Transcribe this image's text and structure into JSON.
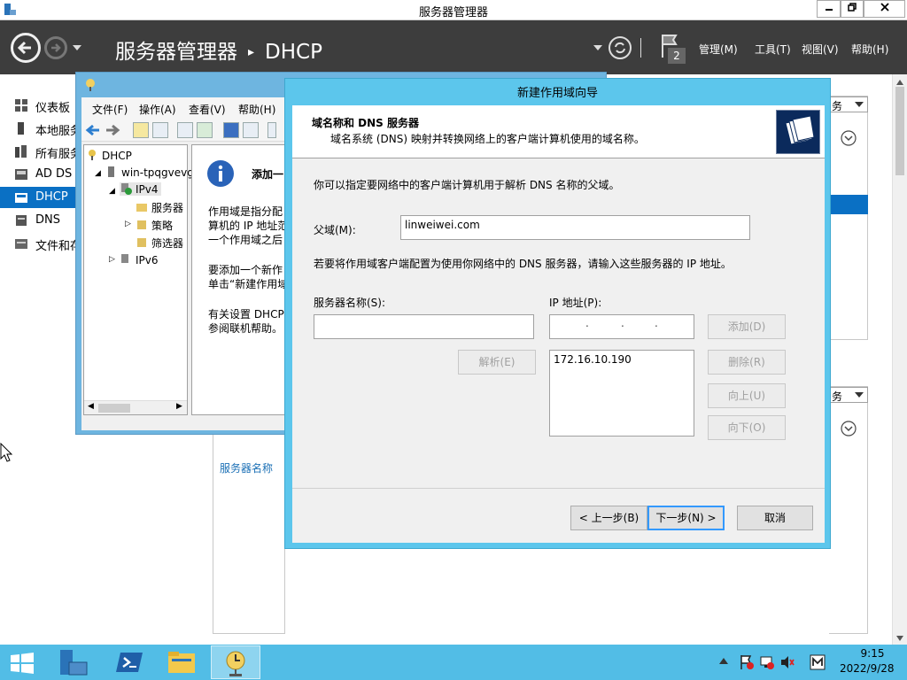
{
  "server_manager": {
    "title": "服务器管理器",
    "breadcrumb_root": "服务器管理器",
    "breadcrumb_sep": "▸",
    "breadcrumb_current": "DHCP",
    "notification_count": "2",
    "menu": {
      "manage": "管理(M)",
      "tools": "工具(T)",
      "view": "视图(V)",
      "help": "帮助(H)"
    },
    "nav": [
      {
        "label": "仪表板",
        "icon": "dashboard-icon"
      },
      {
        "label": "本地服务",
        "icon": "server-icon"
      },
      {
        "label": "所有服务",
        "icon": "servers-icon"
      },
      {
        "label": "AD DS",
        "icon": "ad-ds-icon"
      },
      {
        "label": "DHCP",
        "icon": "dhcp-icon"
      },
      {
        "label": "DNS",
        "icon": "dns-icon"
      },
      {
        "label": "文件和存",
        "icon": "file-storage-icon"
      }
    ],
    "task_label_top": "务",
    "task_label_bottom": "务",
    "server_name_col": "服务器名称"
  },
  "mmc": {
    "menu": {
      "file": "文件(F)",
      "action": "操作(A)",
      "view": "查看(V)",
      "help": "帮助(H)"
    },
    "tree": {
      "root": "DHCP",
      "server": "win-tpqgvevg",
      "ipv4": "IPv4",
      "servers": "服务器",
      "policies": "策略",
      "filters": "筛选器",
      "ipv6": "IPv6"
    },
    "content": {
      "heading": "添加一",
      "p1_l1": "作用域是指分配",
      "p1_l2": "算机的 IP 地址范",
      "p1_l3": "一个作用域之后",
      "p2_l1": "要添加一个新作",
      "p2_l2": "单击“新建作用域",
      "p3_l1": "有关设置 DHCP",
      "p3_l2": "参阅联机帮助。"
    }
  },
  "wizard": {
    "title": "新建作用域向导",
    "banner_title": "域名称和 DNS 服务器",
    "banner_subtitle": "域名系统 (DNS) 映射并转换网络上的客户端计算机使用的域名称。",
    "intro": "你可以指定要网络中的客户端计算机用于解析 DNS 名称的父域。",
    "parent_domain_label": "父域(M):",
    "parent_domain_value": "linweiwei.com",
    "dns_instructions": "若要将作用域客户端配置为使用你网络中的 DNS 服务器，请输入这些服务器的 IP 地址。",
    "server_name_label": "服务器名称(S):",
    "server_name_value": "",
    "ip_label": "IP 地址(P):",
    "ip_list": [
      "172.16.10.190"
    ],
    "buttons": {
      "resolve": "解析(E)",
      "add": "添加(D)",
      "remove": "删除(R)",
      "up": "向上(U)",
      "down": "向下(O)",
      "back": "< 上一步(B)",
      "next": "下一步(N) >",
      "cancel": "取消"
    }
  },
  "taskbar": {
    "time": "9:15",
    "date": "2022/9/28"
  },
  "colors": {
    "header_bg": "#3d3d3d",
    "nav_active": "#0a70c4",
    "wizard_frame": "#5cc6ec",
    "taskbar": "#52bde6"
  }
}
